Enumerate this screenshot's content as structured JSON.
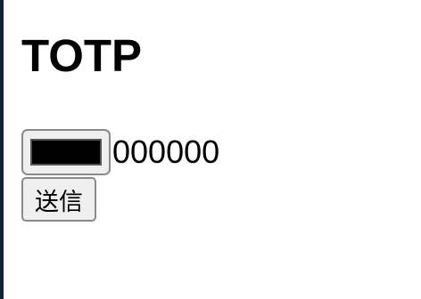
{
  "title": "TOTP",
  "color_input": {
    "value": "#000000"
  },
  "code_text": "000000",
  "submit_label": "送信"
}
